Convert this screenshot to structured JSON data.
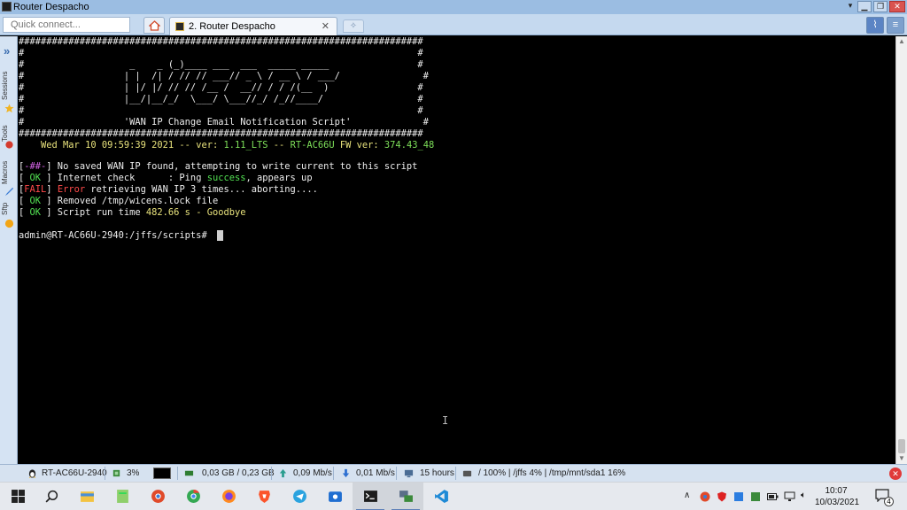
{
  "window": {
    "title": "Router Despacho",
    "controls": [
      "minimize",
      "restore",
      "close"
    ]
  },
  "tabbar": {
    "quick_connect_placeholder": "Quick connect...",
    "tab_label": "2. Router Despacho",
    "tab_close": "✕"
  },
  "sidebar": {
    "labels": [
      "Sessions",
      "Tools",
      "Macros",
      "Sftp"
    ]
  },
  "terminal": {
    "lines": [
      {
        "text": "#########################################################################"
      },
      {
        "text": "#                                                                       #"
      },
      {
        "text": "#                   _    _ (_)____ ___  ___  _____ _____                #"
      },
      {
        "text": "#                  | |  /| / // // ___// _ \\ / __ \\ / ___/               #"
      },
      {
        "text": "#                  | |/ |/ // // /__ /  __// / / /(__  )                #"
      },
      {
        "text": "#                  |__/|__/_/  \\___/ \\___//_/ /_//____/                 #"
      },
      {
        "text": "#                                                                       #"
      },
      {
        "text": "#                  'WAN IP Change Email Notification Script'             #"
      },
      {
        "text": "#########################################################################"
      }
    ],
    "version_line": {
      "date": "    Wed Mar 10 09:59:39 2021",
      "ver_label": " -- ver: ",
      "ver": "1.11_LTS",
      "mid": " -- ",
      "model": "RT-AC66U",
      "fw_label": " FW ver: ",
      "fw": "374.43_48"
    },
    "messages": [
      {
        "pre": "[",
        "tag": "-##-",
        "post": "] No saved WAN IP found, attempting to write current to this script"
      },
      {
        "pre": "[ ",
        "tag": "OK",
        "post": " ] Internet check      : Ping ",
        "hl": "success",
        "post2": ", appears up"
      },
      {
        "pre": "[",
        "tag": "FAIL",
        "post": "] ",
        "hl": "Error",
        "post2": " retrieving WAN IP 3 times... aborting...."
      },
      {
        "pre": "[ ",
        "tag": "OK",
        "post": " ] Removed /tmp/wicens.lock file"
      },
      {
        "pre": "[ ",
        "tag": "OK",
        "post": " ] Script run time ",
        "hl": "482.66 s - Goodbye"
      }
    ],
    "prompt": "admin@RT-AC66U-2940:/jffs/scripts# "
  },
  "statusbar": {
    "host": "RT-AC66U-2940",
    "cpu": "3%",
    "memory": "0,03 GB / 0,23 GB",
    "upload": "0,09 Mb/s",
    "download": "0,01 Mb/s",
    "uptime": "15 hours",
    "disks": "/ 100% | /jffs 4% | /tmp/mnt/sda1 16%"
  },
  "taskbar": {
    "time": "10:07",
    "date": "10/03/2021",
    "notification_count": "4"
  },
  "colors": {
    "green": "#7ee05a",
    "yellow": "#e8e27c",
    "magenta": "#d664e8",
    "red": "#ff4a4a"
  }
}
